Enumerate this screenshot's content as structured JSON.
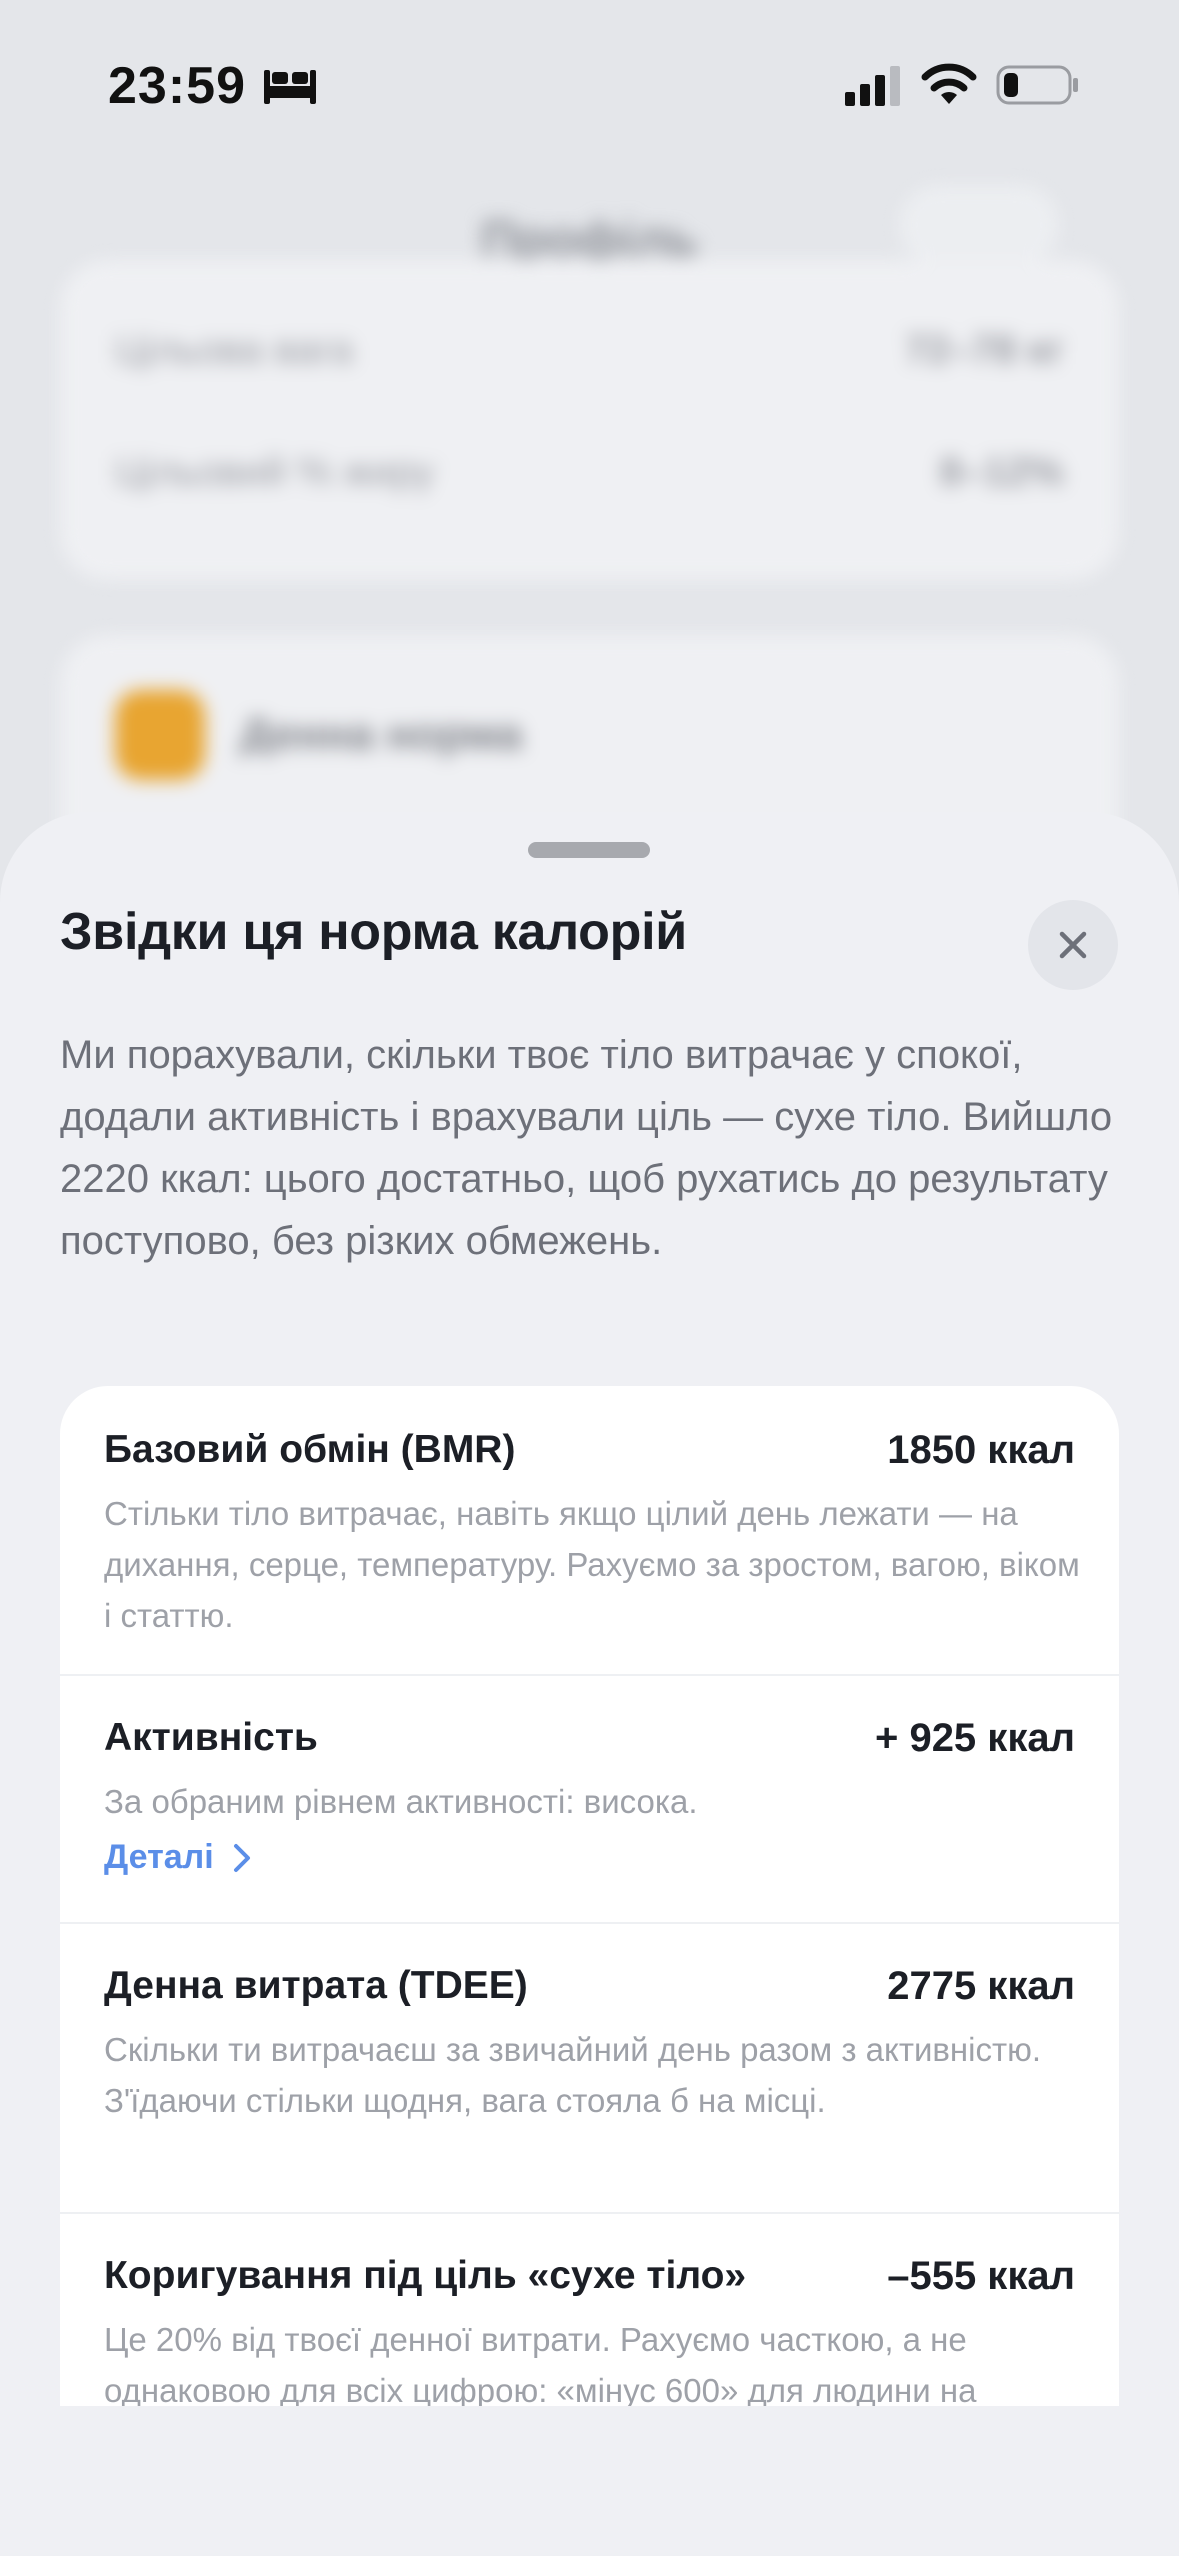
{
  "status_bar": {
    "time": "23:59",
    "icons": [
      "bed-icon",
      "cellular-signal-icon",
      "wifi-icon",
      "battery-icon"
    ]
  },
  "background": {
    "title": "Профіль",
    "rows": [
      {
        "label": "Цільова вага",
        "value": "72–78 кг"
      },
      {
        "label": "Цільовий % жиру",
        "value": "8–12%"
      }
    ],
    "card2_label": "Денна норма",
    "accent": "#e8a531"
  },
  "sheet": {
    "title": "Звідки ця норма калорій",
    "close_icon": "close-icon",
    "intro": "Ми порахували, скільки твоє тіло витрачає у спокої, додали активність і врахували ціль — сухе тіло. Вийшло 2220 ккал: цього достатньо, щоб рухатись до результату поступово, без різких обмежень.",
    "rows": [
      {
        "label": "Базовий обмін (BMR)",
        "value": "1850 ккал",
        "description": "Стільки тіло витрачає, навіть якщо цілий день лежати — на дихання, серце, температуру. Рахуємо за зростом, вагою, віком і статтю."
      },
      {
        "label": "Активність",
        "value": "+ 925 ккал",
        "description": "За обраним рівнем активності: висока.",
        "link": "Деталі"
      },
      {
        "label": "Денна витрата (TDEE)",
        "value": "2775 ккал",
        "description": "Скільки ти витрачаєш за звичайний день разом з активністю. З'їдаючи стільки щодня, вага стояла б на місці."
      },
      {
        "label": "Коригування під ціль «сухе тіло»",
        "value": "–555 ккал",
        "description": "Це 20% від твоєї денної витрати. Рахуємо часткою, а не однаковою для всіх цифрою: «мінус 600» для людини на"
      }
    ],
    "link_color": "#5b8ee8"
  }
}
